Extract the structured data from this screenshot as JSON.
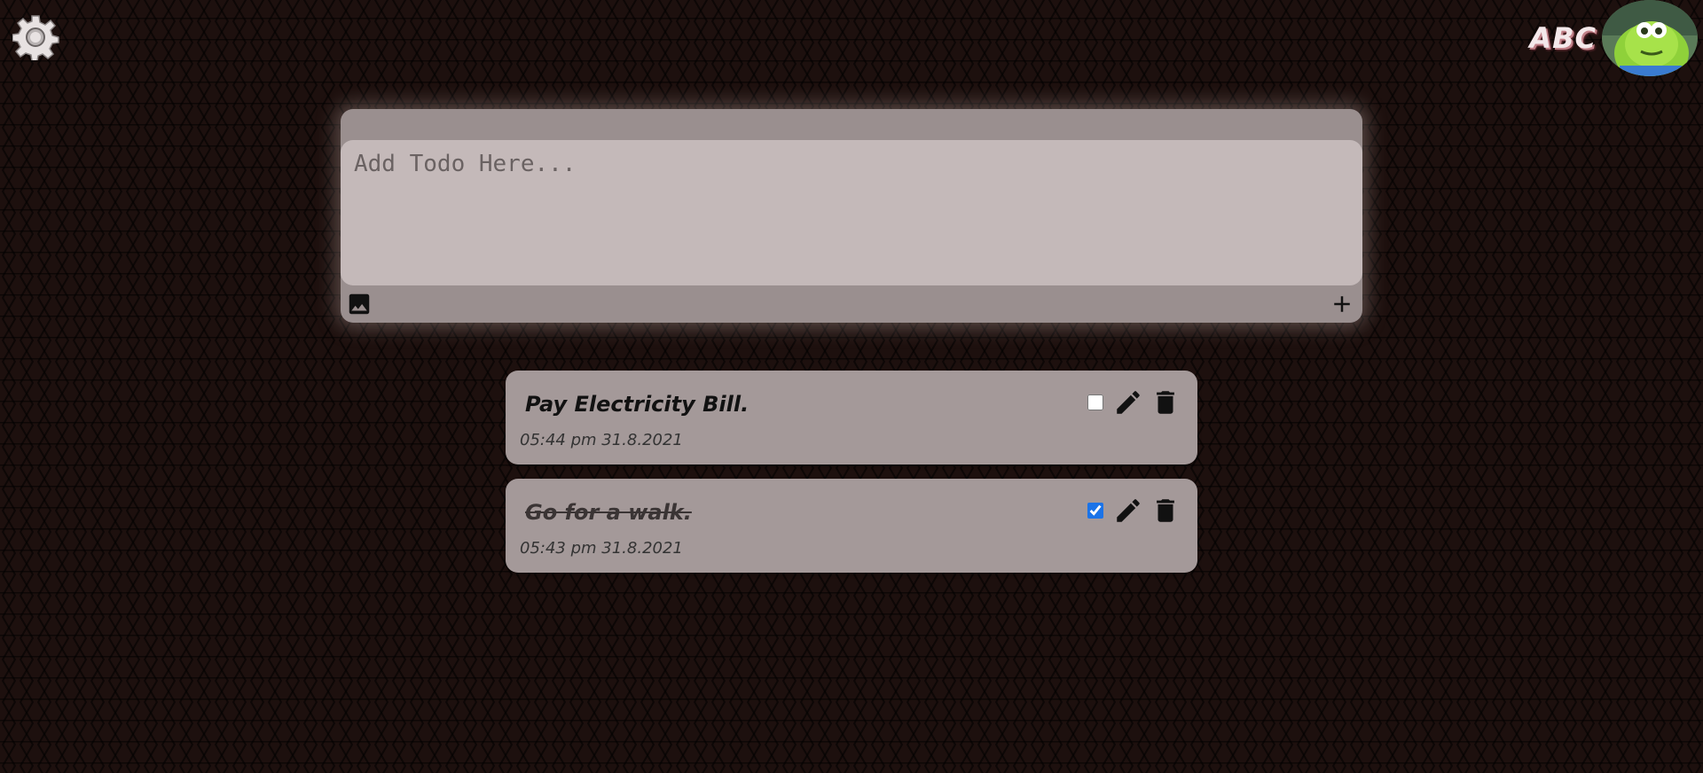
{
  "header": {
    "settings_icon": "gear-icon",
    "user_name": "ABC",
    "avatar_icon": "avatar-image"
  },
  "composer": {
    "placeholder": "Add Todo Here...",
    "image_icon": "image-icon",
    "add_icon": "plus-icon"
  },
  "todos": [
    {
      "text": "Pay Electricity Bill.",
      "time": "05:44 pm 31.8.2021",
      "completed": false
    },
    {
      "text": "Go for a walk.",
      "time": "05:43 pm 31.8.2021",
      "completed": true
    }
  ],
  "colors": {
    "background": "#1d100e",
    "card": "#a49999",
    "composer_input": "#c4b9b9",
    "checkbox_accent": "#1a73e8"
  }
}
